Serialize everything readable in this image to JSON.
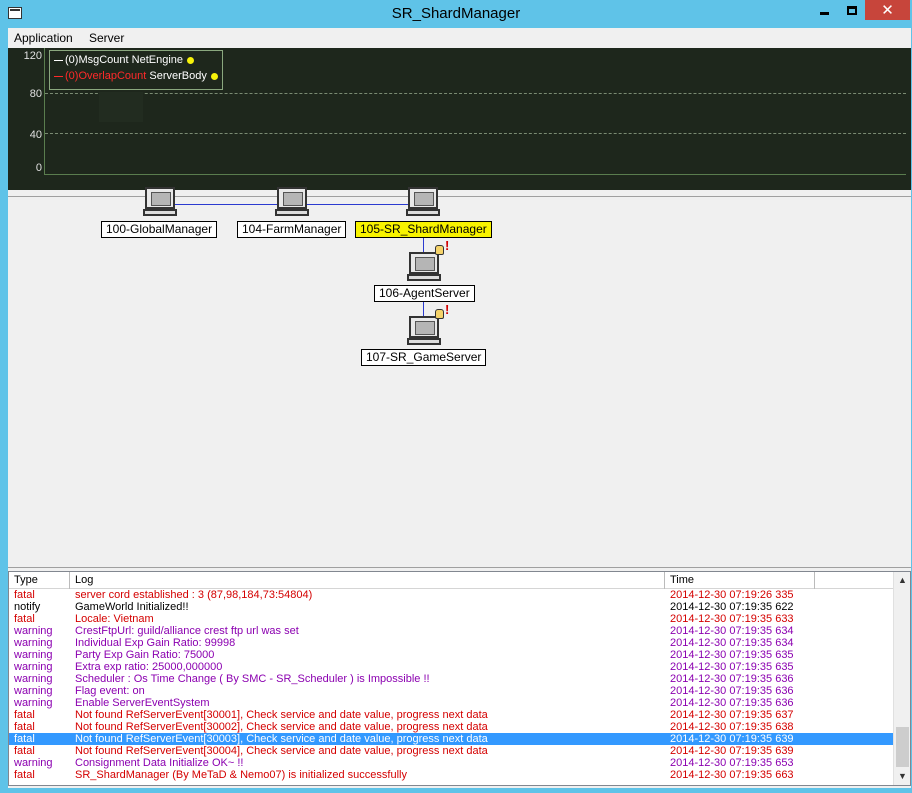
{
  "window": {
    "title": "SR_ShardManager",
    "close_glyph": "✕"
  },
  "menu": {
    "items": [
      {
        "label": "Application"
      },
      {
        "label": "Server"
      }
    ]
  },
  "graph": {
    "y_ticks": [
      "120",
      "80",
      "40",
      "0"
    ],
    "legend": [
      {
        "label": "(0)MsgCount",
        "source": "NetEngine",
        "color": "#ffffff"
      },
      {
        "label": "(0)OverlapCount",
        "source": "ServerBody",
        "color": "#ff2a2a"
      }
    ],
    "marker_color": "#f6f20a"
  },
  "nodes": [
    {
      "label": "100-GlobalManager",
      "selected": false
    },
    {
      "label": "104-FarmManager",
      "selected": false
    },
    {
      "label": "105-SR_ShardManager",
      "selected": true
    },
    {
      "label": "106-AgentServer",
      "selected": false,
      "alert": true
    },
    {
      "label": "107-SR_GameServer",
      "selected": false,
      "alert": true
    }
  ],
  "log": {
    "columns": [
      "Type",
      "Log",
      "Time"
    ],
    "colors": {
      "fatal": "#d40000",
      "notify": "#000000",
      "warning": "#8b00b0"
    },
    "rows": [
      {
        "type": "fatal",
        "text": "server cord established : 3 (87,98,184,73:54804)",
        "time": "2014-12-30 07:19:26 335"
      },
      {
        "type": "notify",
        "text": "GameWorld Initialized!!",
        "time": "2014-12-30 07:19:35 622"
      },
      {
        "type": "fatal",
        "text": "Locale: Vietnam",
        "time": "2014-12-30 07:19:35 633"
      },
      {
        "type": "warning",
        "text": "CrestFtpUrl: guild/alliance crest ftp url was set",
        "time": "2014-12-30 07:19:35 634"
      },
      {
        "type": "warning",
        "text": "Individual Exp Gain Ratio: 99998",
        "time": "2014-12-30 07:19:35 634"
      },
      {
        "type": "warning",
        "text": "Party Exp Gain Ratio: 75000",
        "time": "2014-12-30 07:19:35 635"
      },
      {
        "type": "warning",
        "text": "Extra exp ratio: 25000,000000",
        "time": "2014-12-30 07:19:35 635"
      },
      {
        "type": "warning",
        "text": "Scheduler : Os Time Change ( By SMC - SR_Scheduler ) is Impossible !!",
        "time": "2014-12-30 07:19:35 636"
      },
      {
        "type": "warning",
        "text": "Flag event: on",
        "time": "2014-12-30 07:19:35 636"
      },
      {
        "type": "warning",
        "text": "Enable ServerEventSystem",
        "time": "2014-12-30 07:19:35 636"
      },
      {
        "type": "fatal",
        "text": "Not found RefServerEvent[30001], Check service and date value, progress next data",
        "time": "2014-12-30 07:19:35 637"
      },
      {
        "type": "fatal",
        "text": "Not found RefServerEvent[30002], Check service and date value, progress next data",
        "time": "2014-12-30 07:19:35 638"
      },
      {
        "type": "fatal",
        "text": "Not found RefServerEvent[30003], Check service and date value, progress next data",
        "time": "2014-12-30 07:19:35 639",
        "selected": true
      },
      {
        "type": "fatal",
        "text": "Not found RefServerEvent[30004], Check service and date value, progress next data",
        "time": "2014-12-30 07:19:35 639"
      },
      {
        "type": "warning",
        "text": "Consignment Data Initialize OK~ !!",
        "time": "2014-12-30 07:19:35 653"
      },
      {
        "type": "fatal",
        "text": "SR_ShardManager (By MeTaD & Nemo07) is initialized successfully",
        "time": "2014-12-30 07:19:35 663"
      }
    ]
  }
}
